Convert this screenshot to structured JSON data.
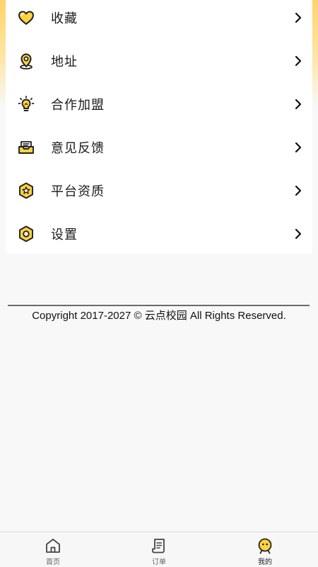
{
  "menu": {
    "items": [
      {
        "label": "收藏",
        "icon": "heart-icon"
      },
      {
        "label": "地址",
        "icon": "location-pin-icon"
      },
      {
        "label": "合作加盟",
        "icon": "lightbulb-icon"
      },
      {
        "label": "意见反馈",
        "icon": "inbox-icon"
      },
      {
        "label": "平台资质",
        "icon": "star-badge-icon"
      },
      {
        "label": "设置",
        "icon": "settings-icon"
      }
    ],
    "accent_color": "#ffd23f"
  },
  "footer": {
    "copyright": "Copyright 2017-2027 © 云点校园 All Rights Reserved."
  },
  "tabbar": {
    "tabs": [
      {
        "label": "首页",
        "icon": "home-icon"
      },
      {
        "label": "订单",
        "icon": "order-list-icon"
      },
      {
        "label": "我的",
        "icon": "profile-face-icon",
        "active": true
      }
    ]
  }
}
